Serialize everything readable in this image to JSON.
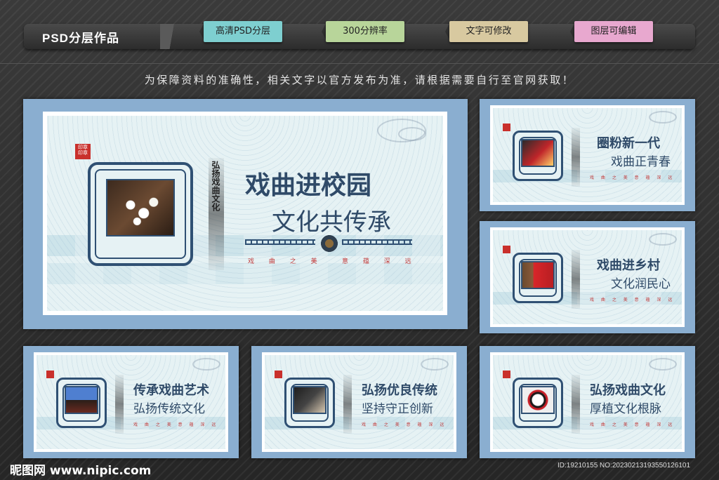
{
  "header": {
    "brand": "PSD分层作品",
    "tags": [
      {
        "label": "高清PSD分层",
        "color": "#7ecfd0"
      },
      {
        "label": "300分辨率",
        "color": "#b8d59a"
      },
      {
        "label": "文字可修改",
        "color": "#d8c9a0"
      },
      {
        "label": "图层可编辑",
        "color": "#e8a8cf"
      }
    ]
  },
  "notice": "为保障资料的准确性，相关文字以官方发布为准，请根据需要自行至官网获取！",
  "main_board": {
    "title": "戏曲进校园",
    "subtitle": "文化共传承",
    "vertical": "弘扬戏曲文化",
    "motto_left": "戏 曲 之 美",
    "motto_right": "意 蕴 深 远",
    "photo_icon": "plum-blossom-photo"
  },
  "boards": [
    {
      "title": "圈粉新一代",
      "subtitle": "戏曲正青春",
      "motto": "戏 曲 之 美   意 蕴 深 远"
    },
    {
      "title": "戏曲进乡村",
      "subtitle": "文化润民心",
      "motto": "戏 曲 之 美   意 蕴 深 远"
    },
    {
      "title": "传承戏曲艺术",
      "subtitle": "弘扬传统文化",
      "motto": "戏 曲 之 美   意 蕴 深 远"
    },
    {
      "title": "弘扬优良传统",
      "subtitle": "坚持守正创新",
      "motto": "戏 曲 之 美   意 蕴 深 远"
    },
    {
      "title": "弘扬戏曲文化",
      "subtitle": "厚植文化根脉",
      "motto": "戏 曲 之 美   意 蕴 深 远"
    }
  ],
  "footer": {
    "logo": "昵图网 www.nipic.com",
    "id": "ID:19210155 NO:20230213193550126101"
  },
  "colors": {
    "board_border": "#8aaed0",
    "navy": "#2f5073",
    "accent_red": "#c23b3b"
  }
}
